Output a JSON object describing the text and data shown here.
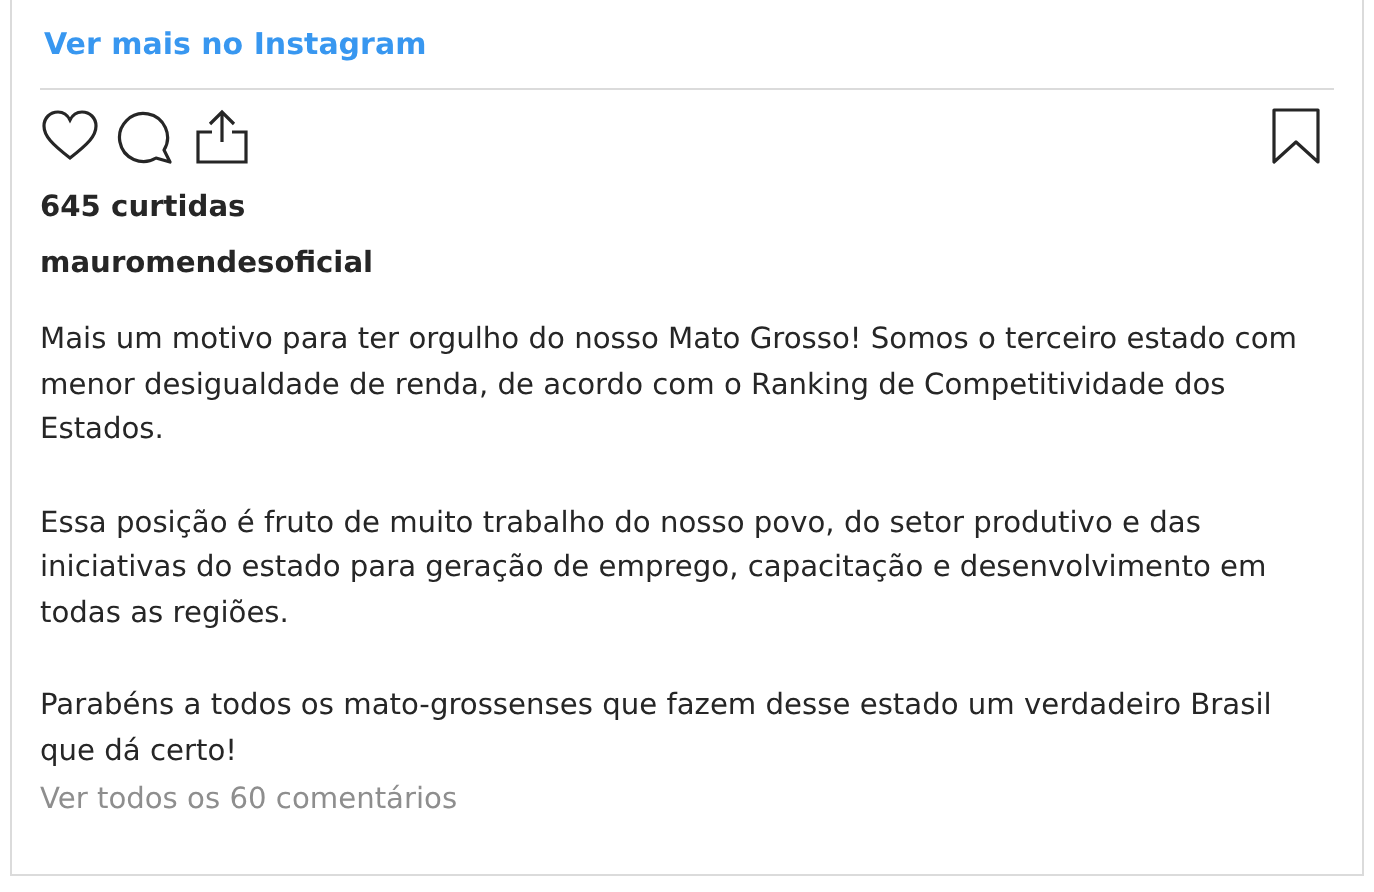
{
  "header_link": "Ver mais no Instagram",
  "actions": {
    "liked": false,
    "saved": false
  },
  "likes": "645 curtidas",
  "username": "mauromendesoficial",
  "caption": [
    "Mais um motivo para ter orgulho do nosso Mato Grosso! Somos o terceiro estado com menor desigualdade de renda, de acordo com o Ranking de Competitividade dos Estados.",
    "Essa posição é fruto de muito trabalho do nosso povo, do setor produtivo e das iniciativas do estado para geração de emprego, capacitação e desenvolvimento em todas as regiões.",
    "Parabéns a todos os mato-grossenses que fazem desse estado um verdadeiro Brasil que dá certo!"
  ],
  "comments_link": "Ver todos os 60 comentários"
}
